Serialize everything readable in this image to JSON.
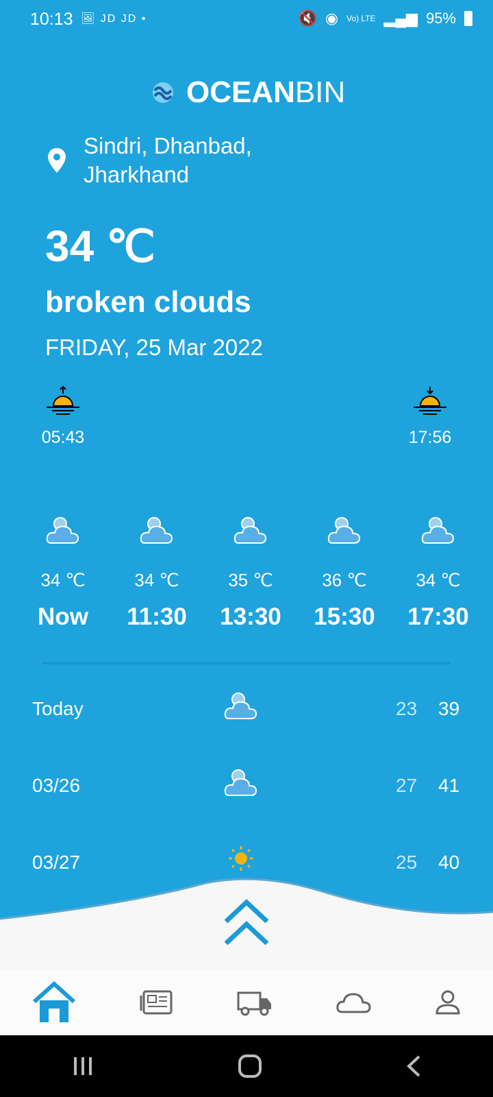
{
  "status_bar": {
    "time": "10:13",
    "left_icons": "🖼 JD JD •",
    "signal_text": "Vo) LTE",
    "battery": "95%"
  },
  "brand": {
    "bold": "OCEAN",
    "light": "BIN"
  },
  "location": {
    "line1": "Sindri, Dhanbad,",
    "line2": "Jharkhand"
  },
  "current": {
    "temperature": "34 ℃",
    "description": "broken clouds",
    "date": "FRIDAY, 25 Mar 2022"
  },
  "sun": {
    "sunrise": "05:43",
    "sunset": "17:56"
  },
  "hourly": [
    {
      "temp": "34 ℃",
      "label": "Now",
      "icon": "cloud-icon"
    },
    {
      "temp": "34 ℃",
      "label": "11:30",
      "icon": "cloud-icon"
    },
    {
      "temp": "35 ℃",
      "label": "13:30",
      "icon": "cloud-icon"
    },
    {
      "temp": "36 ℃",
      "label": "15:30",
      "icon": "cloud-icon"
    },
    {
      "temp": "34 ℃",
      "label": "17:30",
      "icon": "cloud-icon"
    }
  ],
  "daily": [
    {
      "day": "Today",
      "low": "23",
      "high": "39",
      "icon": "cloud-icon"
    },
    {
      "day": "03/26",
      "low": "27",
      "high": "41",
      "icon": "cloud-icon"
    },
    {
      "day": "03/27",
      "low": "25",
      "high": "40",
      "icon": "sun-icon"
    }
  ],
  "nav_items": [
    "home-icon",
    "news-icon",
    "truck-icon",
    "weather-icon",
    "profile-icon"
  ],
  "colors": {
    "background": "#1ea3dd",
    "accent": "#1a9ad6",
    "cloud": "#5aaee8",
    "sun": "#f6b20e"
  }
}
